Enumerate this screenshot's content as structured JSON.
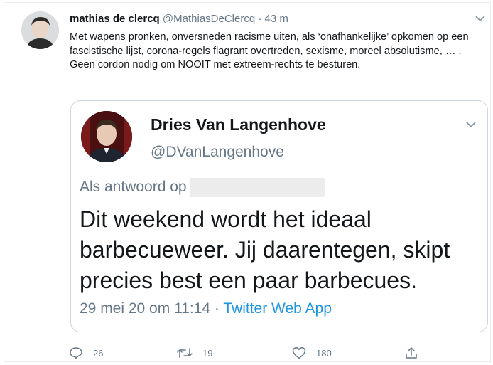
{
  "tweet": {
    "author_name": "mathias de clercq",
    "author_handle": "@MathiasDeClercq",
    "separator": "·",
    "time": "43 m",
    "text": "Met wapens pronken, onversneden racisme uiten, als ‘onafhankelijke’ opkomen op een fascistische lijst, corona-regels flagrant overtreden, sexisme, moreel absolutisme, … . Geen cordon nodig om NOOIT met extreem-rechts te besturen."
  },
  "quoted": {
    "author_name": "Dries Van Langenhove",
    "author_handle": "@DVanLangenhove",
    "reply_prefix": "Als antwoord op",
    "text": "Dit weekend wordt het ideaal barbecueweer. Jij daarentegen, skipt precies best een paar barbecues.",
    "date": "29 mei 20 om 11:14",
    "separator": "·",
    "source": "Twitter Web App"
  },
  "actions": {
    "replies": "26",
    "retweets": "19",
    "likes": "180"
  },
  "colors": {
    "text": "#14171a",
    "muted": "#657786",
    "link": "#1b95e0",
    "border": "#ccd6dd"
  },
  "icons": [
    "chevron-down-icon",
    "reply-icon",
    "retweet-icon",
    "like-icon",
    "share-icon"
  ]
}
